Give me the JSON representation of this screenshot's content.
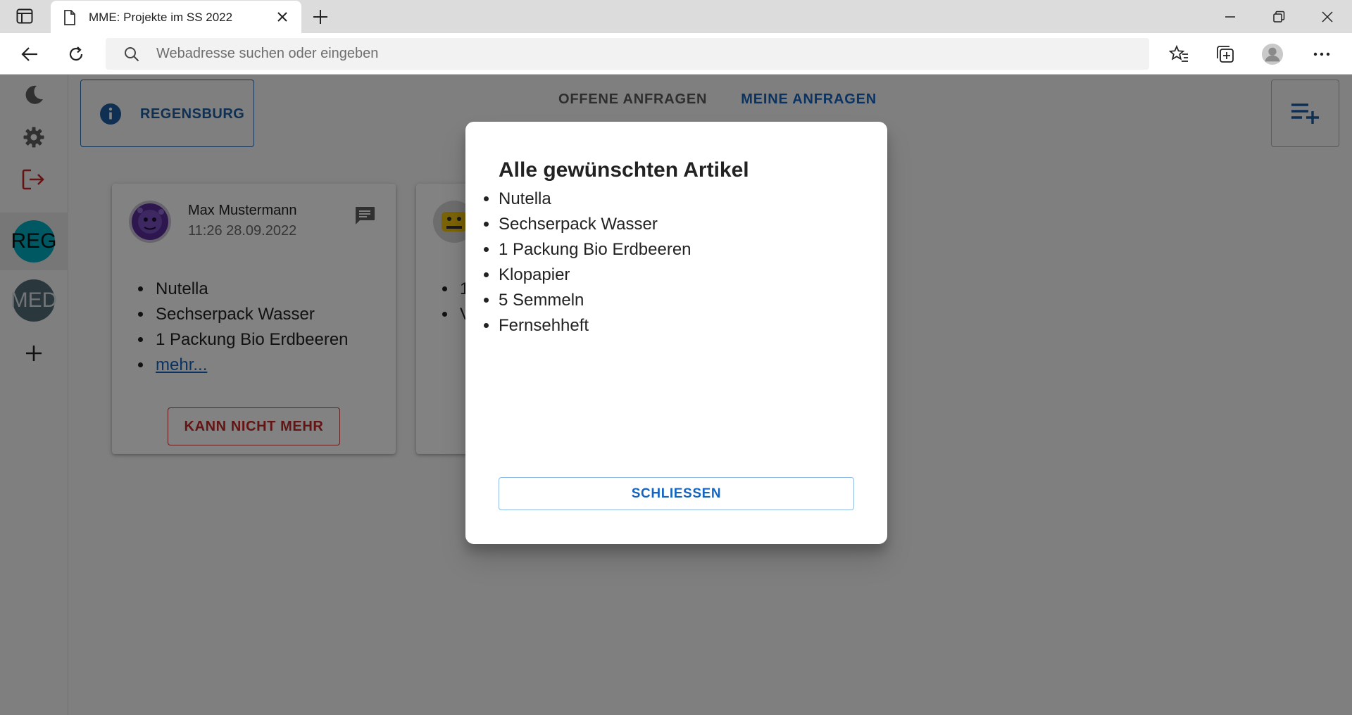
{
  "browser": {
    "tab_title": "MME: Projekte im SS 2022",
    "address_placeholder": "Webadresse suchen oder eingeben"
  },
  "sidebar": {
    "groups": [
      {
        "initials": "REG",
        "color": "#00acc1",
        "active": true
      },
      {
        "initials": "MED",
        "color": "#546e7a",
        "active": false
      }
    ]
  },
  "header": {
    "location": "REGENSBURG",
    "tabs": [
      {
        "label": "OFFENE ANFRAGEN",
        "active": false
      },
      {
        "label": "MEINE ANFRAGEN",
        "active": true
      }
    ]
  },
  "cards": [
    {
      "user": "Max Mustermann",
      "time": "11:26 28.09.2022",
      "items": [
        "Nutella",
        "Sechserpack Wasser",
        "1 Packung Bio Erdbeeren"
      ],
      "more_label": "mehr...",
      "action_label": "KANN NICHT MEHR"
    },
    {
      "items": [
        "1",
        "V"
      ]
    }
  ],
  "dialog": {
    "title": "Alle gewünschten Artikel",
    "items": [
      "Nutella",
      "Sechserpack Wasser",
      "1 Packung Bio Erdbeeren",
      "Klopapier",
      "5 Semmeln",
      "Fernsehheft"
    ],
    "close_label": "SCHLIESSEN"
  },
  "colors": {
    "primary": "#1565c0",
    "danger": "#c62828",
    "reg_avatar": "#00acc1",
    "med_avatar": "#546e7a"
  }
}
